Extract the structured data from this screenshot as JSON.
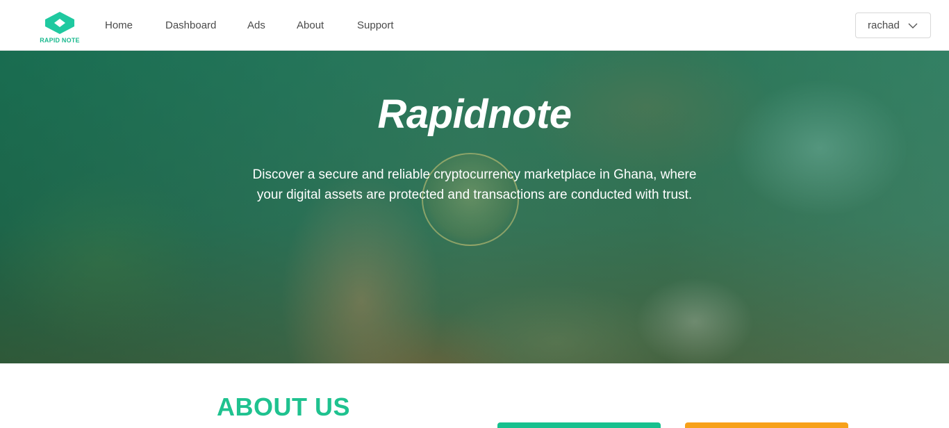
{
  "brand": {
    "logo_text": "RAPID NOTE",
    "accent_color": "#19b98e"
  },
  "nav": {
    "links": [
      "Home",
      "Dashboard",
      "Ads",
      "About",
      "Support"
    ]
  },
  "user_menu": {
    "username": "rachad",
    "icon": "chevron-down-icon"
  },
  "hero": {
    "title": "Rapidnote",
    "description": "Discover a secure and reliable cryptocurrency marketplace in Ghana, where your digital assets are protected and transactions are conducted with trust."
  },
  "about": {
    "heading": "ABOUT US",
    "heading_color": "#1fc28f"
  },
  "cards": {
    "colors": [
      "#17c08e",
      "#f7a11a"
    ]
  }
}
